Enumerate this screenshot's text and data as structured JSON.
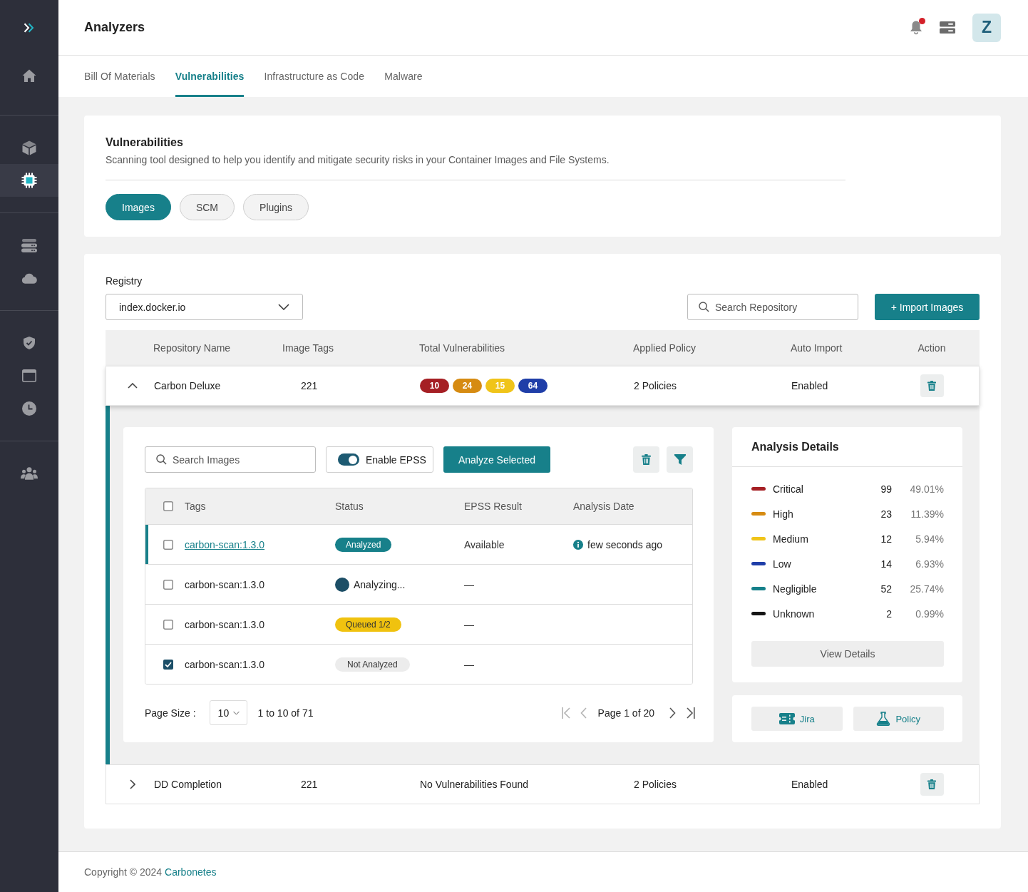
{
  "sidebar": {
    "sections": [
      {
        "items": [
          {
            "selected": false
          }
        ]
      },
      {
        "items": [
          {
            "selected": false
          },
          {
            "selected": true
          }
        ]
      },
      {
        "items": [
          {
            "selected": false
          },
          {
            "selected": false
          }
        ]
      },
      {
        "items": [
          {
            "selected": false
          },
          {
            "selected": false
          },
          {
            "selected": false
          }
        ]
      },
      {
        "items": [
          {
            "selected": false
          }
        ]
      }
    ]
  },
  "header": {
    "title": "Analyzers",
    "notifications_unread": true,
    "avatar": "Z"
  },
  "tabs": [
    {
      "label": "Bill Of Materials",
      "selected": false
    },
    {
      "label": "Vulnerabilities",
      "selected": true
    },
    {
      "label": "Infrastructure as Code",
      "selected": false
    },
    {
      "label": "Malware",
      "selected": false
    }
  ],
  "intro": {
    "title": "Vulnerabilities",
    "description": "Scanning tool designed to help you identify and mitigate security risks in your Container Images and File Systems.",
    "sources": [
      {
        "label": "Images",
        "selected": true
      },
      {
        "label": "SCM",
        "selected": false
      },
      {
        "label": "Plugins",
        "selected": false
      }
    ]
  },
  "registry": {
    "label": "Registry",
    "value": "index.docker.io"
  },
  "repo_search": {
    "placeholder": "Search Repository"
  },
  "import_button": "+ Import Images",
  "repositories": {
    "columns": [
      "Repository Name",
      "Image Tags",
      "Total Vulnerabilities",
      "Applied Policy",
      "Auto Import",
      "Action"
    ],
    "rows": [
      {
        "name": "Carbon Deluxe",
        "image_tags": "221",
        "vulnerabilities": [
          {
            "count": "10",
            "color": "#a51f24"
          },
          {
            "count": "24",
            "color": "#d68b12"
          },
          {
            "count": "15",
            "color": "#f0c419"
          },
          {
            "count": "64",
            "color": "#1f3ea8"
          }
        ],
        "applied_policy": "2 Policies",
        "auto_import": "Enabled",
        "expanded": true,
        "details": {
          "image_search": {
            "placeholder": "Search Images"
          },
          "epss_toggle": {
            "label": "Enable EPSS",
            "on": true
          },
          "analyze_button": "Analyze Selected",
          "images": {
            "columns": [
              "Tags",
              "Status",
              "EPSS Result",
              "Analysis Date"
            ],
            "all_checked": false,
            "rows": [
              {
                "tag": "carbon-scan:1.3.0",
                "active": true,
                "checked": false,
                "status": {
                  "kind": "analyzed",
                  "label": "Analyzed"
                },
                "epss": "Available",
                "analysis_date": "few seconds ago"
              },
              {
                "tag": "carbon-scan:1.3.0",
                "active": false,
                "checked": false,
                "status": {
                  "kind": "analyzing",
                  "label": "Analyzing..."
                },
                "epss": "—"
              },
              {
                "tag": "carbon-scan:1.3.0",
                "active": false,
                "checked": false,
                "status": {
                  "kind": "queued",
                  "label": "Queued 1/2"
                },
                "epss": "—"
              },
              {
                "tag": "carbon-scan:1.3.0",
                "active": false,
                "checked": true,
                "status": {
                  "kind": "not_analyzed",
                  "label": "Not Analyzed"
                },
                "epss": "—"
              }
            ]
          },
          "pagination": {
            "page_size_label": "Page Size :",
            "page_size": "10",
            "range": "1 to 10 of 71",
            "page": "Page 1 of 20",
            "buttons": [
              {
                "disabled": true
              },
              {
                "disabled": true
              },
              {
                "disabled": false
              },
              {
                "disabled": false
              }
            ]
          },
          "analysis": {
            "title": "Analysis Details",
            "severities": [
              {
                "label": "Critical",
                "count": "99",
                "percent": "49.01%",
                "color": "#a51f24"
              },
              {
                "label": "High",
                "count": "23",
                "percent": "11.39%",
                "color": "#d68b12"
              },
              {
                "label": "Medium",
                "count": "12",
                "percent": "5.94%",
                "color": "#f0c419"
              },
              {
                "label": "Low",
                "count": "14",
                "percent": "6.93%",
                "color": "#1f3ea8"
              },
              {
                "label": "Negligible",
                "count": "52",
                "percent": "25.74%",
                "color": "#15808a"
              },
              {
                "label": "Unknown",
                "count": "2",
                "percent": "0.99%",
                "color": "#151515"
              }
            ],
            "view_button": "View Details"
          },
          "integrations": [
            {
              "label": "Jira"
            },
            {
              "label": "Policy"
            }
          ]
        }
      },
      {
        "name": "DD Completion",
        "image_tags": "221",
        "vulnerabilities_text": "No Vulnerabilities Found",
        "applied_policy": "2 Policies",
        "auto_import": "Enabled",
        "expanded": false
      }
    ]
  },
  "footer": {
    "copyright": "Copyright © 2024",
    "link": "Carbonetes"
  }
}
